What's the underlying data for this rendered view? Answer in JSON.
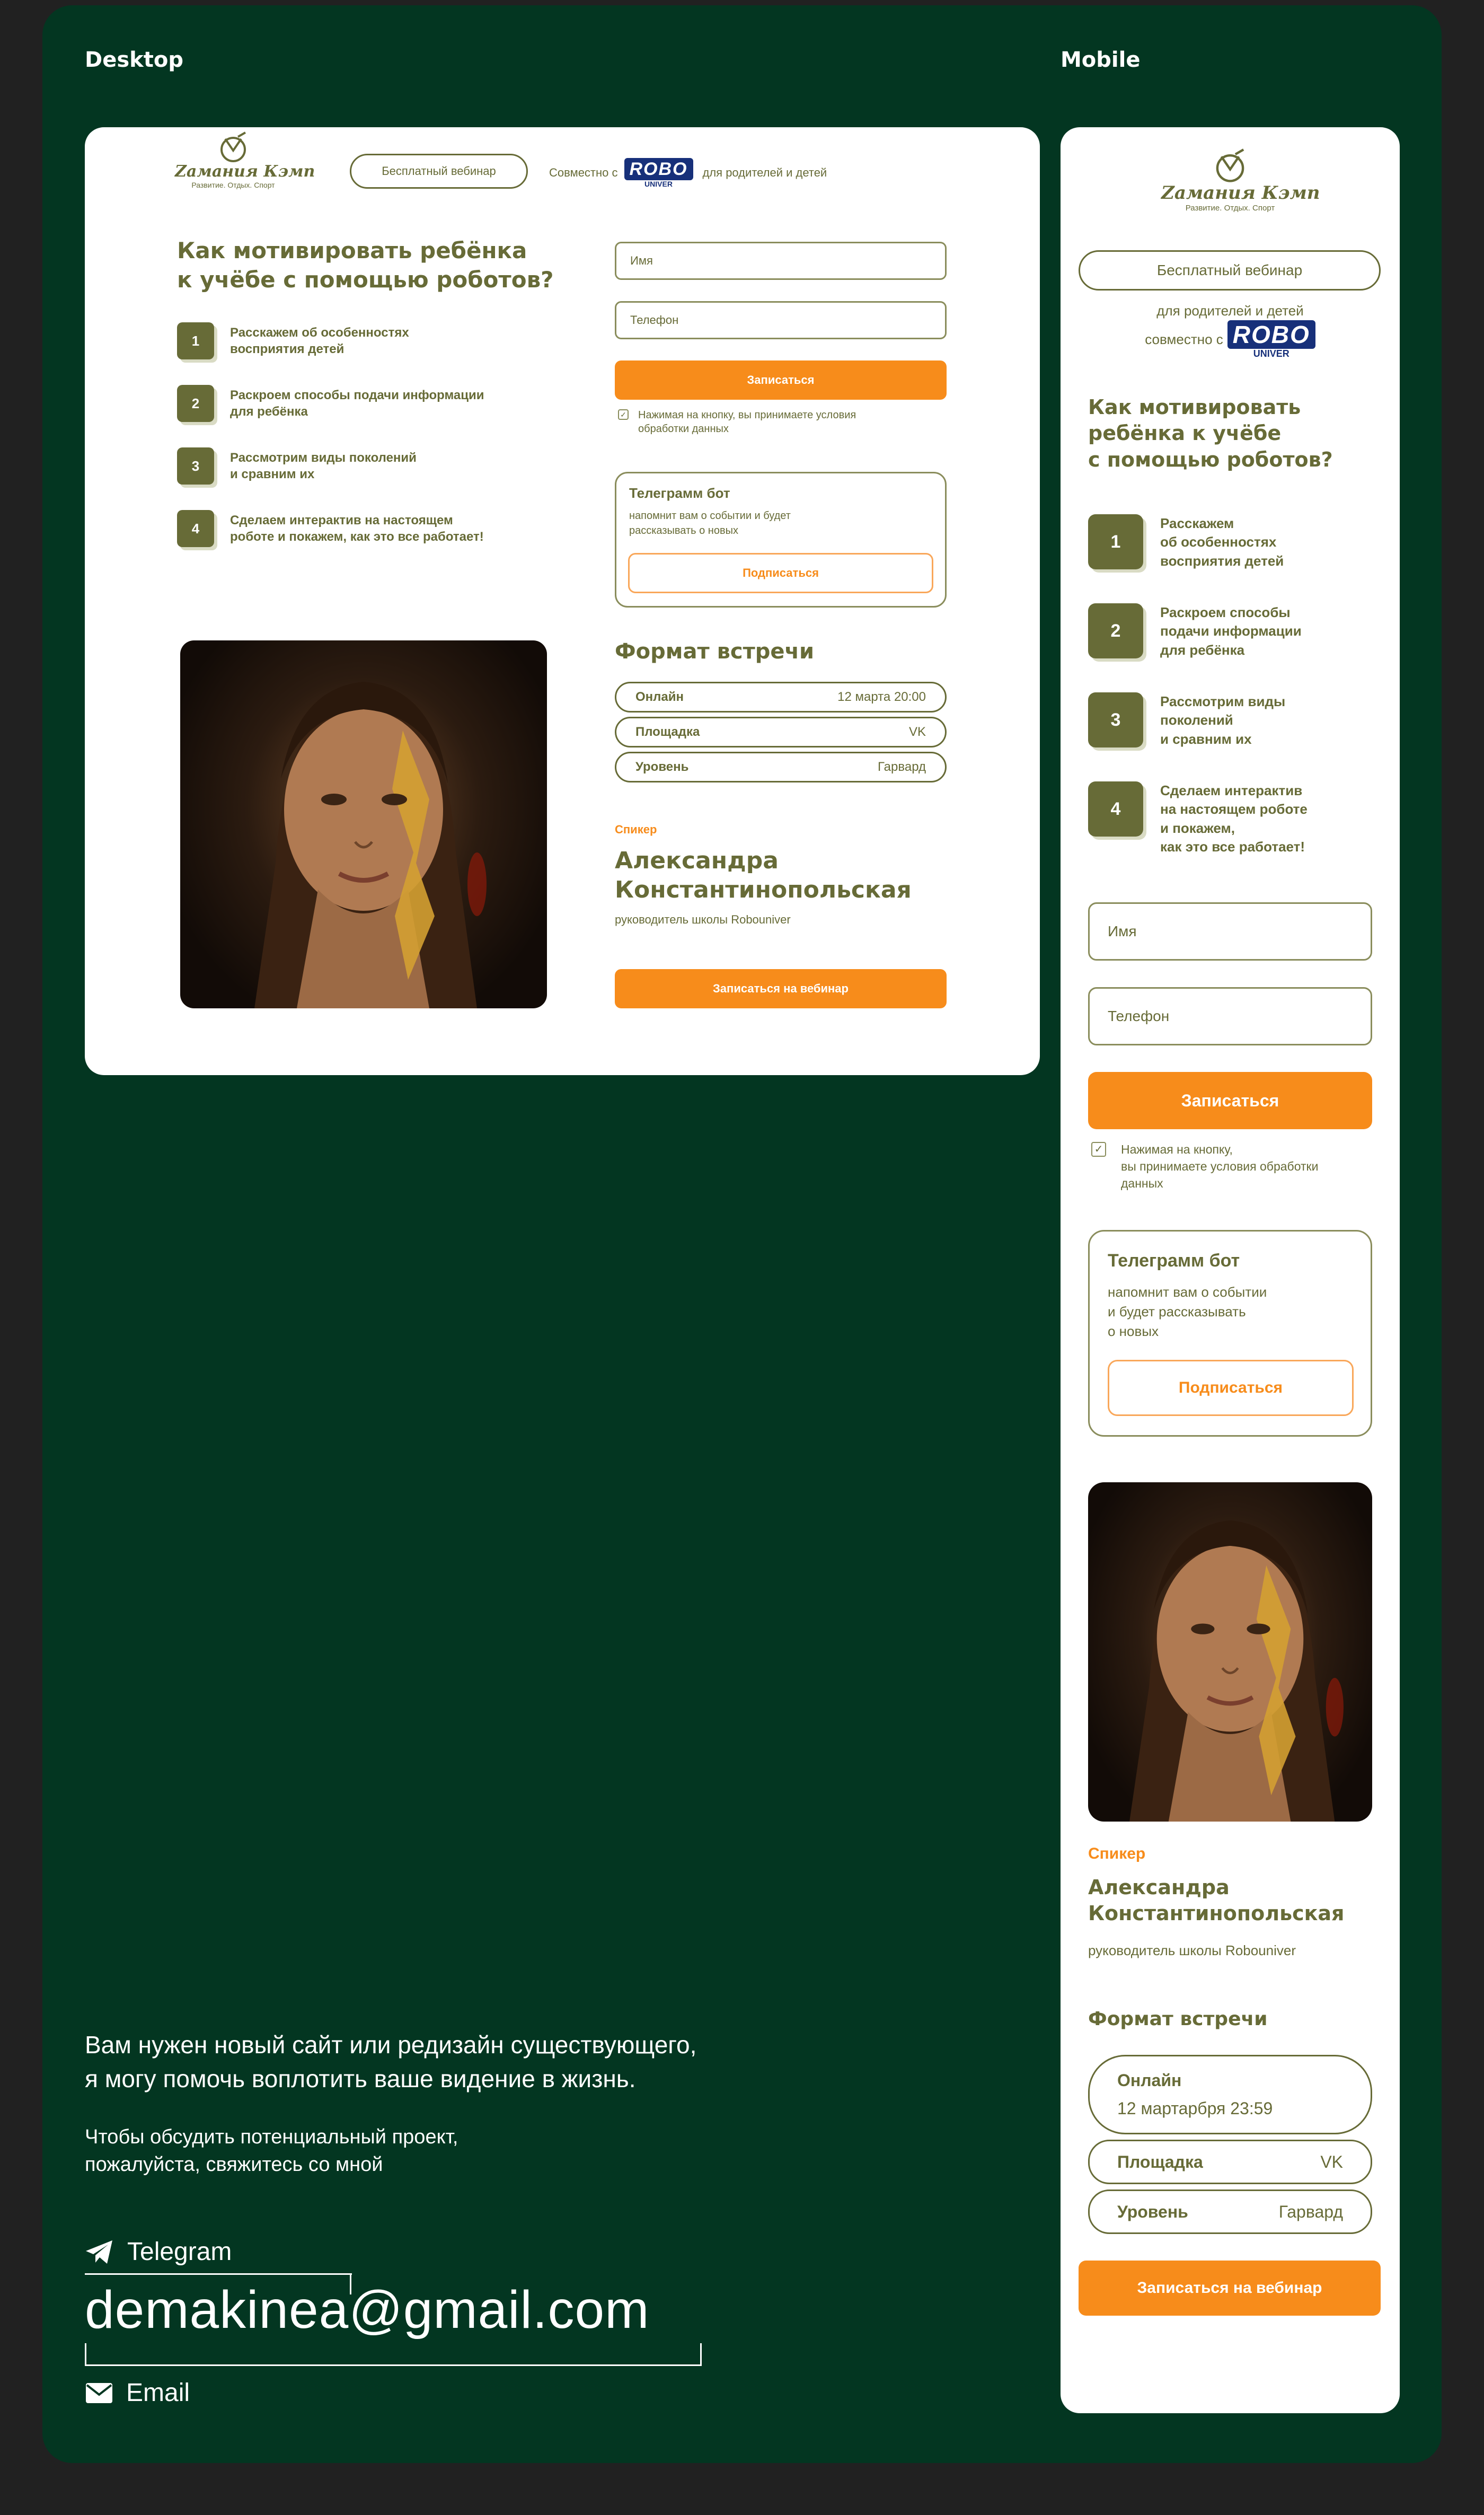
{
  "labels": {
    "desktop": "Desktop",
    "mobile": "Mobile"
  },
  "brand": {
    "name": "Zамания Кэмп",
    "tagline": "Развитие. Отдых. Спорт"
  },
  "header": {
    "webinar_pill": "Бесплатный вебинар",
    "together_with": "Совместно с",
    "partner_top": "ROBO",
    "partner_bottom": "UNIVER",
    "audience": "для родителей и детей"
  },
  "mobile_header": {
    "partner_line1": "для родителей и детей",
    "partner_line2": "совместно с"
  },
  "hero": {
    "title_desktop": "Как мотивировать ребёнка\nк учёбе с помощью роботов?",
    "title_mobile": "Как мотивировать\nребёнка к учёбе\nс помощью роботов?"
  },
  "steps": [
    {
      "num": "1",
      "desktop": "Расскажем об особенностях\nвосприятия детей",
      "mobile": "Расскажем\nоб особенностях\nвосприятия детей"
    },
    {
      "num": "2",
      "desktop": "Раскроем способы подачи информации\nдля ребёнка",
      "mobile": "Раскроем способы\nподачи информации\nдля ребёнка"
    },
    {
      "num": "3",
      "desktop": "Рассмотрим виды поколений\nи сравним их",
      "mobile": "Рассмотрим виды\nпоколений\nи сравним их"
    },
    {
      "num": "4",
      "desktop": "Сделаем интерактив на настоящем\nроботе и покажем, как это все работает!",
      "mobile": "Сделаем интерактив\nна настоящем роботе\nи покажем,\nкак это все работает!"
    }
  ],
  "form": {
    "name_placeholder": "Имя",
    "phone_placeholder": "Телефон",
    "submit": "Записаться",
    "consent_desktop": "Нажимая на кнопку, вы принимаете условия\nобработки данных",
    "consent_mobile": "Нажимая на кнопку,\nвы принимаете условия обработки\nданных"
  },
  "telegram_bot": {
    "title": "Телеграмм бот",
    "desc_desktop": "напомнит вам о событии и будет\nрассказывать о новых",
    "desc_mobile": "напомнит вам о событии\nи будет рассказывать\nо новых",
    "button": "Подписаться"
  },
  "meeting": {
    "title": "Формат встречи",
    "rows_desktop": [
      {
        "key": "Онлайн",
        "value": "12 марта 20:00"
      },
      {
        "key": "Площадка",
        "value": "VK"
      },
      {
        "key": "Уровень",
        "value": "Гарвард"
      }
    ],
    "rows_mobile": [
      {
        "key": "Онлайн",
        "value": "12 мартарбря 23:59"
      },
      {
        "key": "Площадка",
        "value": "VK"
      },
      {
        "key": "Уровень",
        "value": "Гарвард"
      }
    ]
  },
  "speaker": {
    "label": "Спикер",
    "name": "Александра\nКонстантинопольская",
    "role": "руководитель школы Robouniver"
  },
  "cta": {
    "register_webinar": "Записаться на вебинар"
  },
  "contact": {
    "headline": "Вам нужен новый сайт или редизайн существующего,\nя могу помочь воплотить ваше видение в жизнь.",
    "subline": "Чтобы обсудить потенциальный проект,\nпожалуйста, свяжитесь со мной",
    "telegram": "Telegram",
    "email_address": "demakinea@gmail.com",
    "email_label": "Email"
  },
  "colors": {
    "board": "#033621",
    "page": "#212121",
    "olive": "#676b37",
    "orange": "#f78c1b",
    "robo_blue": "#17307a"
  }
}
